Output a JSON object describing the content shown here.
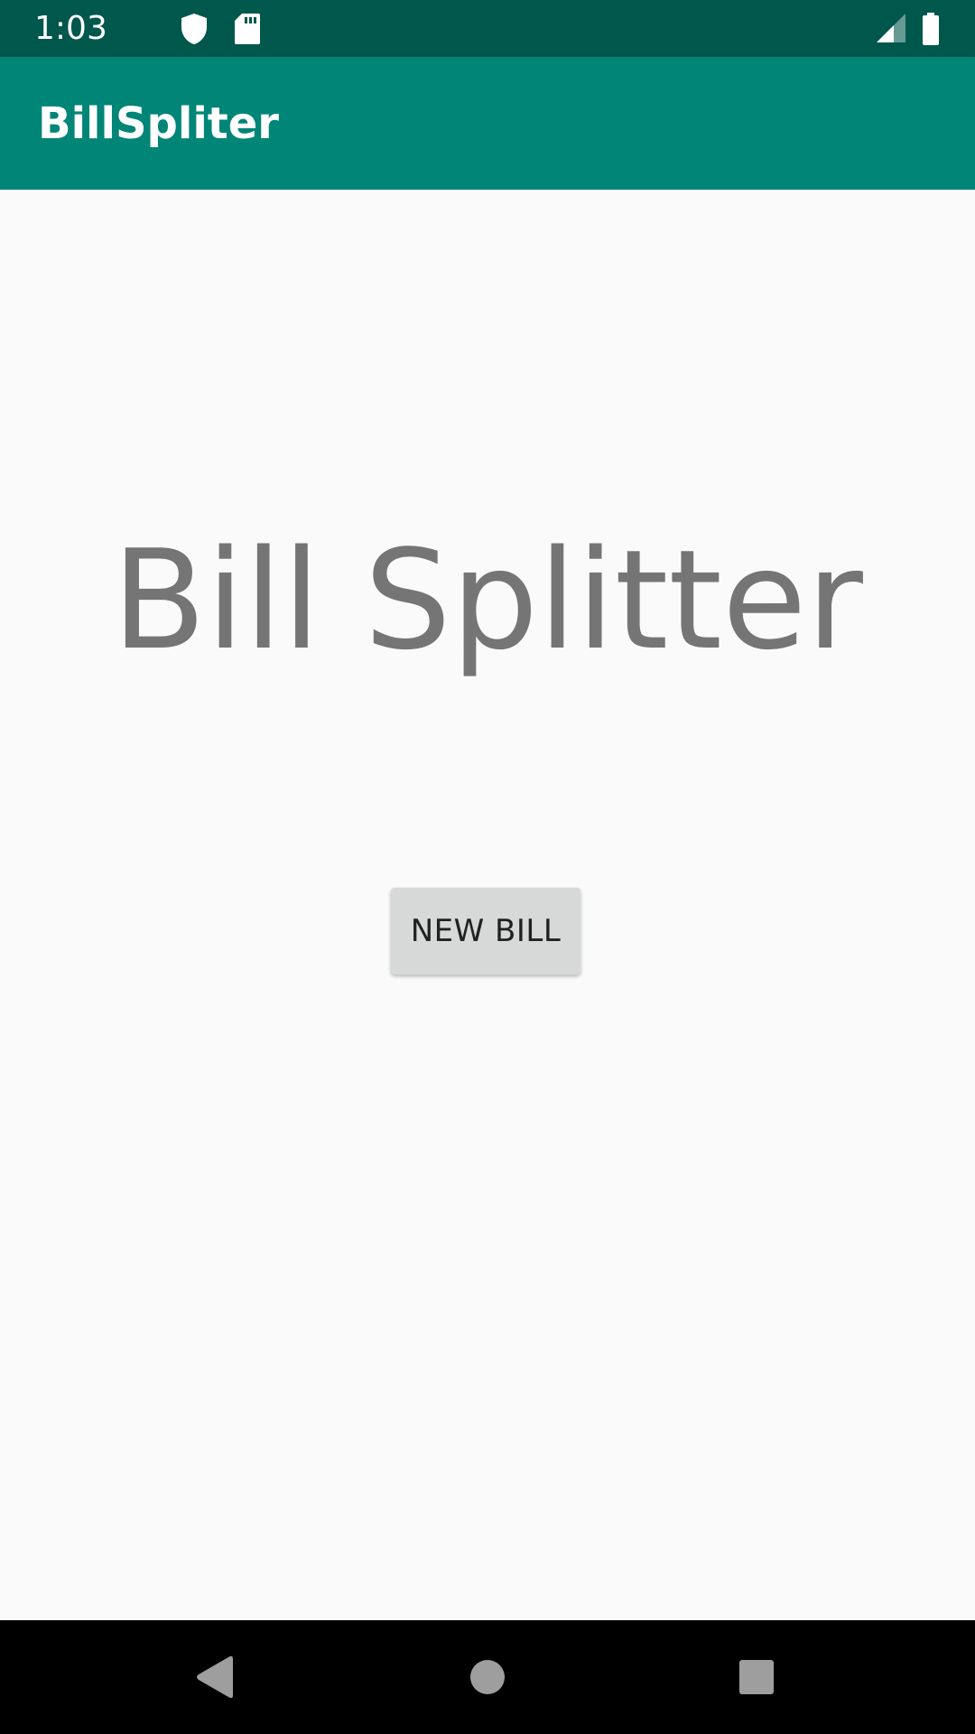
{
  "status_bar": {
    "time": "1:03",
    "icons": [
      "shield-icon",
      "sd-card-icon",
      "signal-icon",
      "battery-icon"
    ]
  },
  "app_bar": {
    "title": "BillSpliter",
    "color": "#008577"
  },
  "main": {
    "heading": "Bill Splitter",
    "new_bill_label": "NEW BILL"
  },
  "nav_bar": {
    "buttons": [
      "back-icon",
      "home-icon",
      "recents-icon"
    ]
  },
  "colors": {
    "status_bar": "#00574b",
    "app_bar": "#008577",
    "background": "#fafafa",
    "heading_text": "#757575",
    "button_bg": "#d7d8d8"
  }
}
